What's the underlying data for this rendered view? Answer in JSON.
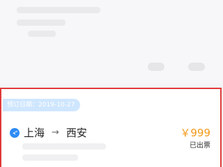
{
  "order": {
    "date_label": "预订日期：2019-10-27",
    "origin": "上海",
    "arrow": "→",
    "destination": "西安",
    "price": "￥999",
    "status": "已出票"
  },
  "colors": {
    "accent": "#2f8cf4",
    "price": "#f39a1a",
    "highlight_border": "#e03a3a"
  },
  "icons": {
    "route_icon": "plane-icon"
  }
}
